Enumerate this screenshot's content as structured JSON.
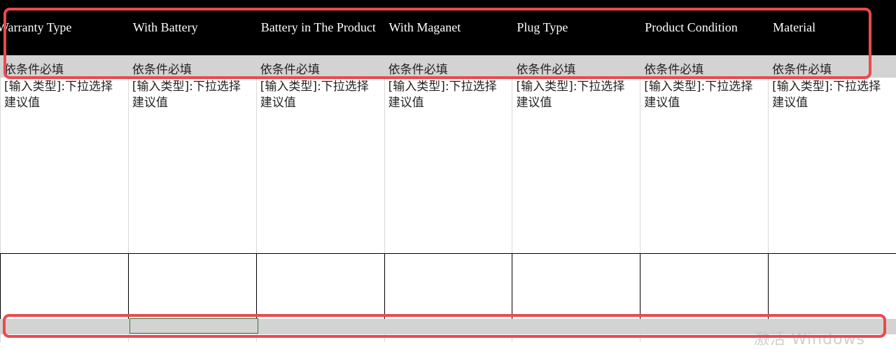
{
  "headers": [
    "Warranty Type",
    "With Battery",
    "Battery in The Product",
    "With Maganet",
    "Plug Type",
    "Product Condition",
    "Material"
  ],
  "requirement": "依条件必填",
  "description_line1": "[输入类型]:下拉选择",
  "description_line2": "建议值",
  "watermark": "激活 Windows",
  "colors": {
    "header_bg": "#000000",
    "required_bg": "#d3d3d3",
    "highlight": "#e94a50",
    "selected_border": "#2e7d32"
  }
}
